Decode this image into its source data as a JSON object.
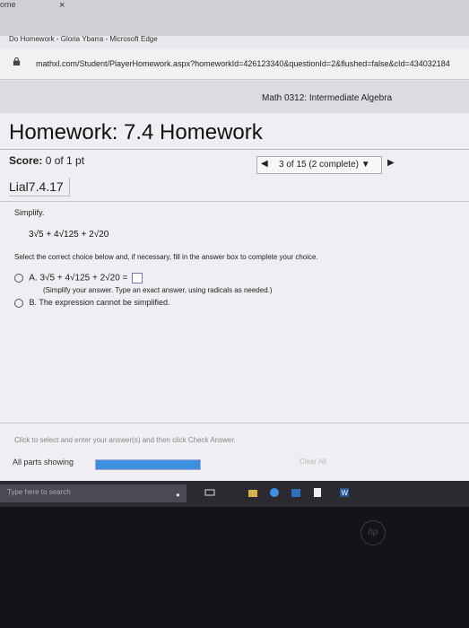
{
  "browser": {
    "tab_prev": "ome",
    "tab_close": "×",
    "window_title": "Do Homework - Gloria Ybarra - Microsoft Edge",
    "url": "mathxl.com/Student/PlayerHomework.aspx?homeworkId=426123340&questionId=2&flushed=false&cId=434032184"
  },
  "course": "Math 0312: Intermediate Algebra",
  "homework": {
    "title": "Homework: 7.4 Homework",
    "score_label": "Score:",
    "score_value": "0 of 1 pt",
    "nav_status": "3 of 15 (2 complete) ▼",
    "question_id": "Lial7.4.17"
  },
  "question": {
    "prompt": "Simplify.",
    "expression": "3√5 + 4√125 + 2√20",
    "instruction": "Select the correct choice below and, if necessary, fill in the answer box to complete your choice.",
    "option_a_label": "A.",
    "option_a_expr": "3√5 + 4√125 + 2√20 =",
    "option_a_hint": "(Simplify your answer. Type an exact answer, using radicals as needed.)",
    "option_b_label": "B.",
    "option_b_text": "The expression cannot be simplified."
  },
  "footer": {
    "click_msg": "Click to select and enter your answer(s) and then click Check Answer.",
    "all_parts": "All parts showing",
    "progress": 1.0,
    "clear_all": "Clear All"
  },
  "taskbar": {
    "search_placeholder": "Type here to search"
  },
  "colors": {
    "accent": "#3d8fe0",
    "taskbar": "#2b2a30"
  }
}
